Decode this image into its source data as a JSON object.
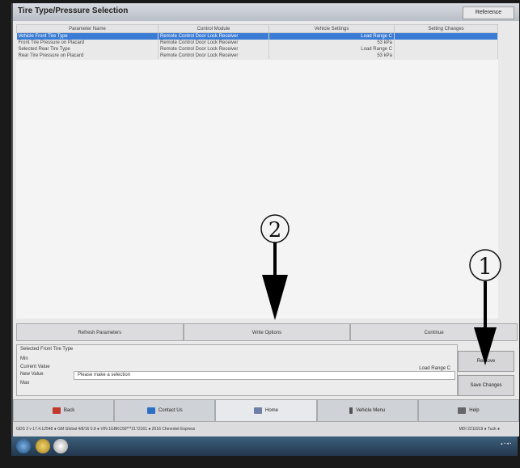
{
  "window": {
    "title": "Tire Type/Pressure Selection",
    "top_button": "Reference"
  },
  "table": {
    "headers": [
      "Parameter Name",
      "Control Module",
      "Vehicle Settings",
      "Setting Changes"
    ],
    "rows": [
      {
        "name": "Vehicle Front Tire Type",
        "module": "Remote Control Door Lock Receiver",
        "setting": "Load Range C",
        "selected": true
      },
      {
        "name": "Front Tire Pressure on Placard",
        "module": "Remote Control Door Lock Receiver",
        "setting": "53 kPa"
      },
      {
        "name": "Selected Rear Tire Type",
        "module": "Remote Control Door Lock Receiver",
        "setting": "Load Range C"
      },
      {
        "name": "Rear Tire Pressure on Placard",
        "module": "Remote Control Door Lock Receiver",
        "setting": "53 kPa"
      }
    ]
  },
  "options_bar": {
    "btn1": "Refresh Parameters",
    "btn2": "Write Options",
    "btn3": "Continue"
  },
  "selected": {
    "legend": "Selected Front Tire Type",
    "min_label": "Min",
    "current_label": "Current Value",
    "current_value": "Load Range C",
    "new_label": "New Value",
    "new_placeholder": "Please make a selection",
    "max_label": "Max"
  },
  "side": {
    "remove_btn": "Remove",
    "save_btn": "Save Changes"
  },
  "nav": {
    "back": "Back",
    "contact": "Contact Us",
    "home": "Home",
    "vehicle": "Vehicle Menu",
    "help": "Help"
  },
  "status": {
    "left": "GDS 2 v 17.4.12548  ● GM Global 4/8/16 0.8  ● VIN 1GBKC59***2172161  ● 2016 Chevrolet Express",
    "right": "MDI 2211919   ● Tuck   ●"
  },
  "annotations": {
    "one": "①",
    "two": "②"
  },
  "colors": {
    "selected_row": "#3a7bd5"
  }
}
